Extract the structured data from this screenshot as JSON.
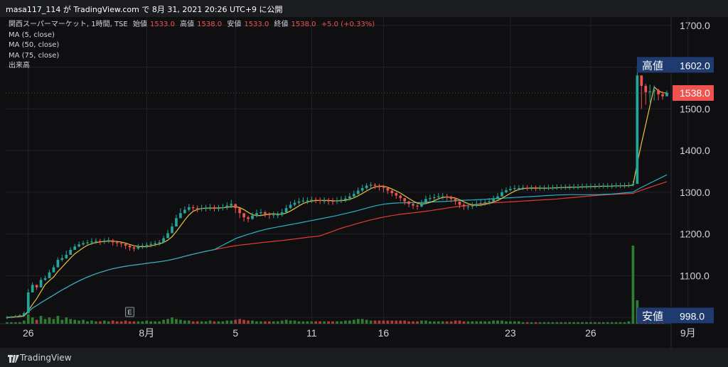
{
  "header": {
    "text": "masa117_114 が TradingView.com で 8月 31, 2021 20:26 UTC+9 に公開"
  },
  "legend": {
    "symbol": "関西スーパーマーケット, 1時間, TSE",
    "open_label": "始値",
    "open": "1533.0",
    "high_label": "高値",
    "high": "1538.0",
    "low_label": "安値",
    "low": "1533.0",
    "close_label": "終値",
    "close": "1538.0",
    "change": "+5.0 (+0.33%)",
    "ma5": "MA (5, close)",
    "ma50": "MA (50, close)",
    "ma75": "MA (75, close)",
    "volume": "出来高"
  },
  "footer": {
    "brand": "TradingView"
  },
  "colors": {
    "up": "#26a69a",
    "down": "#ef5350",
    "ma5": "#e8c33a",
    "ma50": "#26b3c8",
    "ma75": "#e53935",
    "label_bg": "#1e3a6e"
  },
  "chart_data": {
    "type": "candlestick",
    "y_ticks": [
      "1700.0",
      "1600.0",
      "1500.0",
      "1400.0",
      "1300.0",
      "1200.0",
      "1100.0",
      "1000.0"
    ],
    "ylim": [
      985,
      1720
    ],
    "x_ticks": [
      "26",
      "8月",
      "5",
      "11",
      "16",
      "23",
      "26",
      "9月"
    ],
    "x_tick_index": [
      5,
      33,
      54,
      72,
      89,
      119,
      138,
      161
    ],
    "high_label": "高値",
    "high_value": "1602.0",
    "low_label": "安値",
    "low_value": "998.0",
    "last_price": "1538.0",
    "event_marker": "E",
    "event_index": 29,
    "close": [
      1000,
      1001,
      1003,
      1005,
      1010,
      1060,
      1078,
      1072,
      1090,
      1094,
      1108,
      1120,
      1138,
      1142,
      1150,
      1162,
      1170,
      1175,
      1178,
      1180,
      1182,
      1183,
      1182,
      1184,
      1185,
      1180,
      1178,
      1176,
      1172,
      1168,
      1165,
      1170,
      1172,
      1174,
      1176,
      1178,
      1180,
      1190,
      1202,
      1218,
      1238,
      1250,
      1258,
      1264,
      1262,
      1260,
      1262,
      1262,
      1264,
      1262,
      1262,
      1264,
      1268,
      1272,
      1262,
      1250,
      1240,
      1236,
      1244,
      1250,
      1252,
      1248,
      1245,
      1246,
      1246,
      1252,
      1262,
      1270,
      1275,
      1278,
      1280,
      1280,
      1282,
      1281,
      1280,
      1280,
      1279,
      1278,
      1280,
      1282,
      1285,
      1290,
      1296,
      1304,
      1310,
      1316,
      1318,
      1316,
      1312,
      1310,
      1304,
      1298,
      1292,
      1286,
      1278,
      1272,
      1268,
      1266,
      1274,
      1284,
      1286,
      1288,
      1290,
      1290,
      1288,
      1284,
      1278,
      1270,
      1266,
      1266,
      1268,
      1272,
      1274,
      1276,
      1278,
      1284,
      1290,
      1300,
      1305,
      1308,
      1310,
      1310,
      1311,
      1310,
      1310,
      1309,
      1310,
      1310,
      1311,
      1311,
      1312,
      1312,
      1312,
      1312,
      1313,
      1313,
      1314,
      1314,
      1314,
      1314,
      1315,
      1315,
      1315,
      1315,
      1316,
      1316,
      1316,
      1317,
      1320,
      1580,
      1555,
      1540,
      1542,
      1545,
      1535,
      1530,
      1538
    ],
    "high": [
      1004,
      1004,
      1006,
      1008,
      1014,
      1068,
      1084,
      1078,
      1096,
      1100,
      1114,
      1126,
      1144,
      1150,
      1160,
      1168,
      1176,
      1182,
      1184,
      1186,
      1190,
      1190,
      1188,
      1190,
      1192,
      1188,
      1184,
      1182,
      1178,
      1174,
      1172,
      1176,
      1178,
      1180,
      1182,
      1184,
      1186,
      1196,
      1210,
      1226,
      1246,
      1262,
      1266,
      1272,
      1270,
      1268,
      1270,
      1270,
      1272,
      1270,
      1270,
      1272,
      1276,
      1282,
      1270,
      1258,
      1248,
      1244,
      1252,
      1258,
      1260,
      1256,
      1252,
      1254,
      1254,
      1260,
      1270,
      1278,
      1282,
      1286,
      1288,
      1288,
      1290,
      1288,
      1288,
      1288,
      1286,
      1286,
      1288,
      1290,
      1292,
      1298,
      1304,
      1312,
      1318,
      1322,
      1324,
      1322,
      1320,
      1318,
      1312,
      1306,
      1300,
      1294,
      1286,
      1280,
      1276,
      1274,
      1282,
      1292,
      1294,
      1296,
      1298,
      1298,
      1296,
      1292,
      1286,
      1278,
      1274,
      1274,
      1276,
      1280,
      1282,
      1284,
      1286,
      1292,
      1298,
      1308,
      1312,
      1315,
      1317,
      1317,
      1318,
      1317,
      1317,
      1316,
      1317,
      1317,
      1318,
      1318,
      1319,
      1319,
      1319,
      1319,
      1320,
      1320,
      1321,
      1321,
      1321,
      1321,
      1322,
      1322,
      1322,
      1322,
      1323,
      1323,
      1323,
      1324,
      1327,
      1602,
      1580,
      1560,
      1558,
      1556,
      1548,
      1542,
      1544
    ],
    "low": [
      996,
      998,
      1000,
      1002,
      1006,
      1040,
      1070,
      1066,
      1080,
      1088,
      1100,
      1112,
      1130,
      1134,
      1140,
      1152,
      1162,
      1168,
      1172,
      1174,
      1174,
      1176,
      1174,
      1176,
      1178,
      1172,
      1170,
      1168,
      1164,
      1160,
      1158,
      1162,
      1164,
      1166,
      1168,
      1170,
      1172,
      1178,
      1192,
      1206,
      1226,
      1240,
      1248,
      1254,
      1254,
      1252,
      1254,
      1254,
      1256,
      1254,
      1254,
      1256,
      1258,
      1262,
      1250,
      1238,
      1230,
      1228,
      1234,
      1240,
      1242,
      1240,
      1236,
      1238,
      1238,
      1242,
      1252,
      1260,
      1266,
      1270,
      1272,
      1272,
      1274,
      1274,
      1272,
      1272,
      1270,
      1270,
      1272,
      1274,
      1276,
      1280,
      1286,
      1294,
      1300,
      1306,
      1308,
      1308,
      1304,
      1300,
      1296,
      1290,
      1284,
      1278,
      1270,
      1264,
      1260,
      1258,
      1264,
      1274,
      1278,
      1280,
      1282,
      1282,
      1280,
      1276,
      1270,
      1262,
      1258,
      1258,
      1260,
      1264,
      1266,
      1268,
      1270,
      1276,
      1282,
      1290,
      1298,
      1302,
      1304,
      1304,
      1305,
      1304,
      1304,
      1303,
      1304,
      1304,
      1305,
      1305,
      1306,
      1306,
      1306,
      1306,
      1307,
      1307,
      1308,
      1308,
      1308,
      1308,
      1309,
      1309,
      1309,
      1309,
      1310,
      1310,
      1310,
      1311,
      1314,
      1480,
      1500,
      1510,
      1515,
      1520,
      1520,
      1522,
      1530
    ],
    "volume": [
      2,
      2,
      2,
      2,
      4,
      12,
      8,
      5,
      10,
      6,
      8,
      6,
      10,
      5,
      8,
      6,
      5,
      4,
      5,
      3,
      4,
      3,
      3,
      4,
      3,
      4,
      3,
      3,
      4,
      3,
      3,
      3,
      3,
      4,
      3,
      3,
      3,
      5,
      6,
      8,
      6,
      5,
      4,
      4,
      3,
      3,
      3,
      3,
      4,
      3,
      3,
      3,
      4,
      4,
      5,
      6,
      5,
      4,
      4,
      3,
      3,
      3,
      3,
      3,
      3,
      4,
      5,
      4,
      4,
      3,
      3,
      3,
      3,
      3,
      3,
      3,
      3,
      3,
      3,
      3,
      4,
      4,
      5,
      6,
      6,
      5,
      4,
      4,
      4,
      4,
      4,
      4,
      4,
      4,
      4,
      3,
      3,
      3,
      4,
      4,
      3,
      3,
      3,
      3,
      3,
      3,
      4,
      4,
      3,
      3,
      3,
      3,
      3,
      3,
      3,
      4,
      4,
      4,
      3,
      3,
      3,
      3,
      2,
      2,
      2,
      2,
      2,
      2,
      2,
      2,
      2,
      2,
      2,
      2,
      2,
      2,
      2,
      2,
      2,
      2,
      2,
      2,
      2,
      2,
      2,
      2,
      2,
      3,
      100,
      30,
      14,
      10,
      8,
      6,
      5,
      4
    ]
  }
}
